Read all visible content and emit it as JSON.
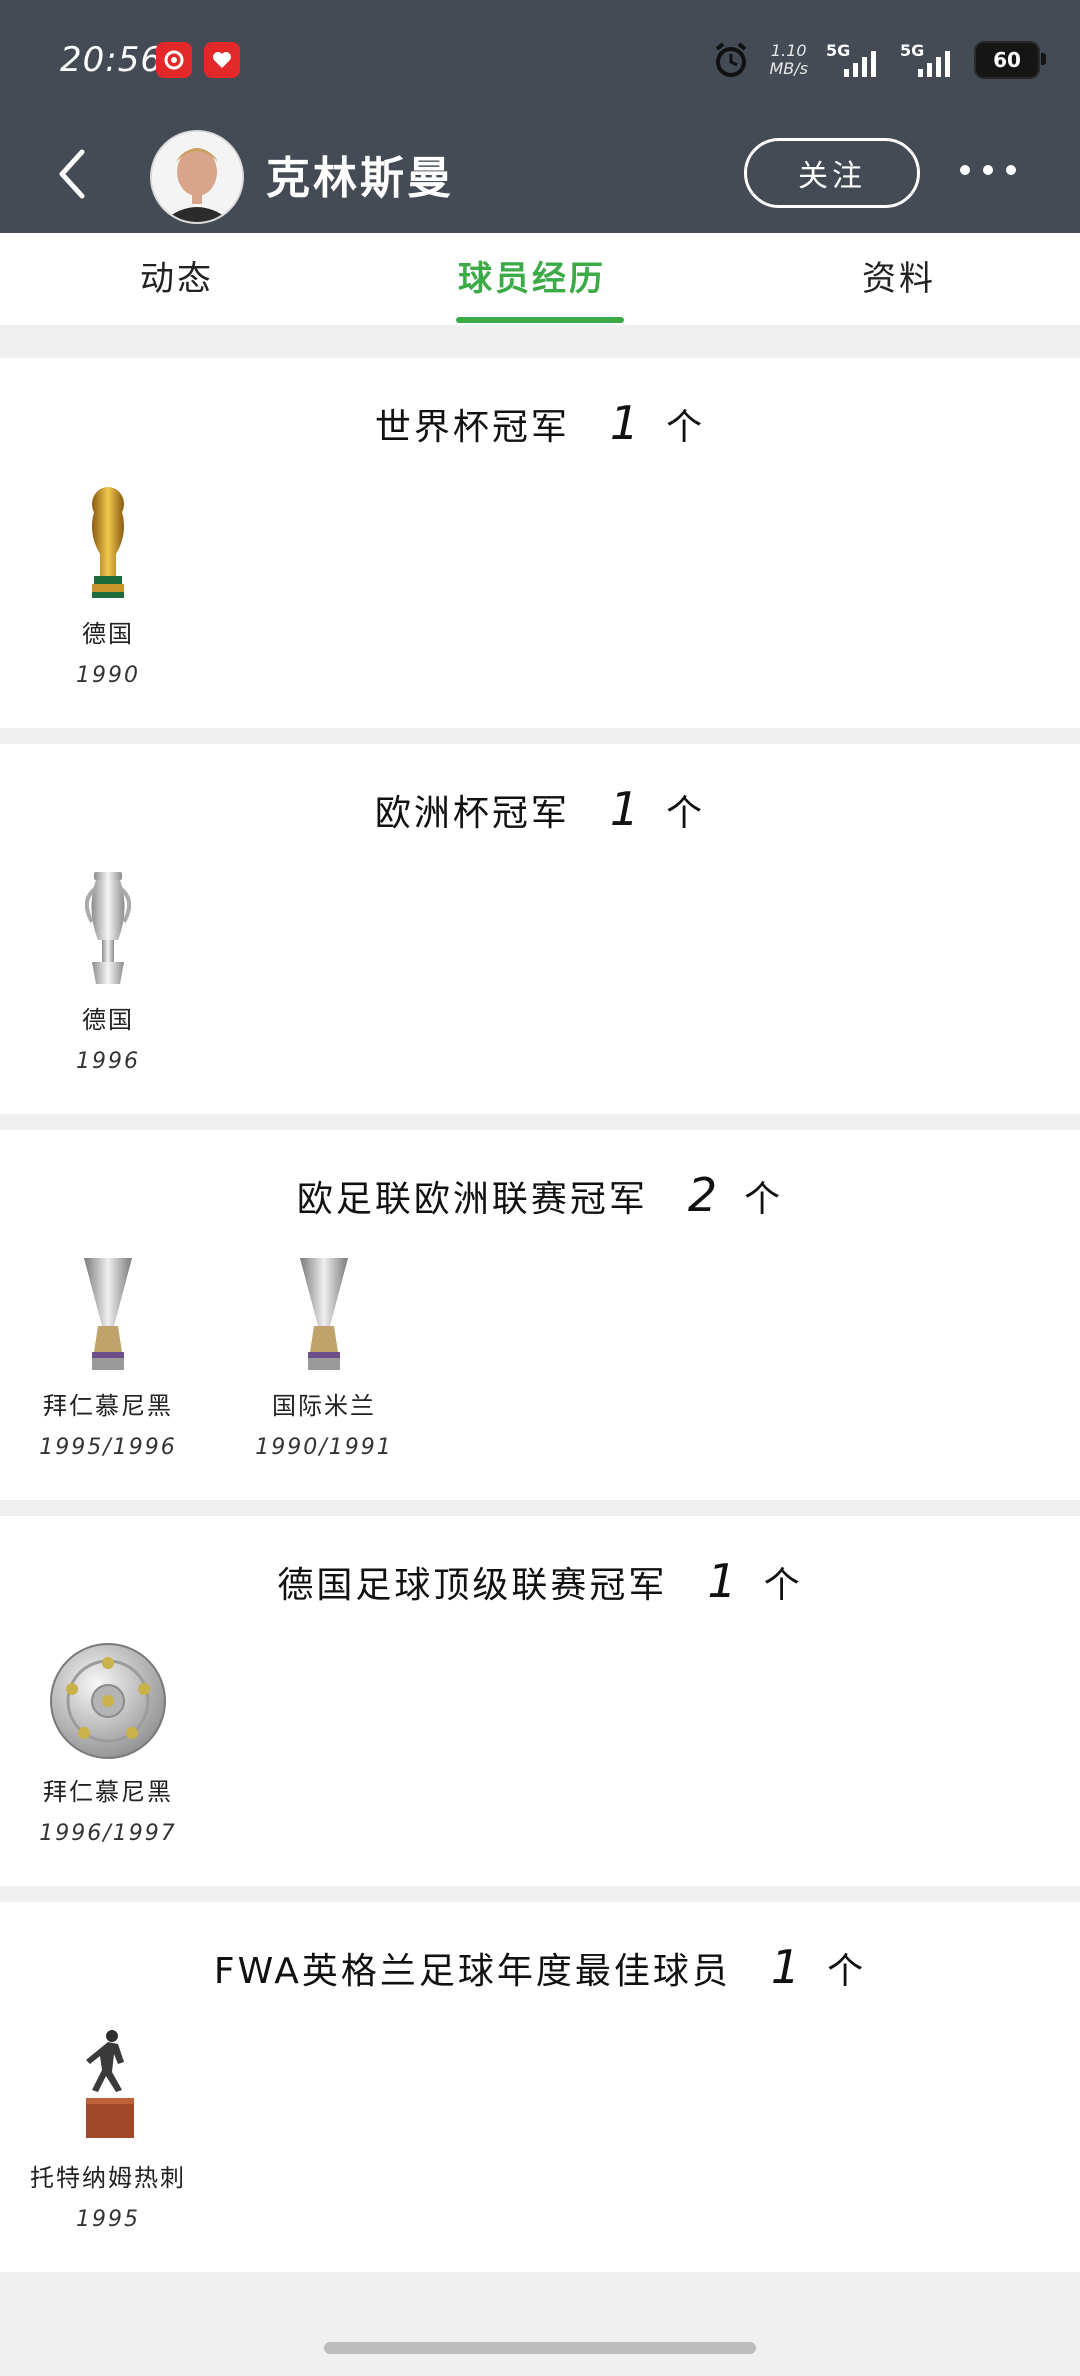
{
  "status_bar": {
    "time": "20:56",
    "net_speed_value": "1.10",
    "net_speed_unit": "MB/s",
    "sim1_label": "5G",
    "sim2_label": "5G",
    "battery": "60"
  },
  "header": {
    "player_name": "克林斯曼",
    "follow_label": "关注"
  },
  "tabs": [
    {
      "label": "动态",
      "active": false
    },
    {
      "label": "球员经历",
      "active": true
    },
    {
      "label": "资料",
      "active": false
    }
  ],
  "sections": [
    {
      "title": "世界杯冠军",
      "count": "1",
      "unit": "个",
      "trophies": [
        {
          "team": "德国",
          "year": "1990",
          "icon": "world-cup-trophy-icon"
        }
      ]
    },
    {
      "title": "欧洲杯冠军",
      "count": "1",
      "unit": "个",
      "trophies": [
        {
          "team": "德国",
          "year": "1996",
          "icon": "euro-cup-trophy-icon"
        }
      ]
    },
    {
      "title": "欧足联欧洲联赛冠军",
      "count": "2",
      "unit": "个",
      "trophies": [
        {
          "team": "拜仁慕尼黑",
          "year": "1995/1996",
          "icon": "uefa-cup-trophy-icon"
        },
        {
          "team": "国际米兰",
          "year": "1990/1991",
          "icon": "uefa-cup-trophy-icon"
        }
      ]
    },
    {
      "title": "德国足球顶级联赛冠军",
      "count": "1",
      "unit": "个",
      "trophies": [
        {
          "team": "拜仁慕尼黑",
          "year": "1996/1997",
          "icon": "bundesliga-shield-icon"
        }
      ]
    },
    {
      "title": "FWA英格兰足球年度最佳球员",
      "count": "1",
      "unit": "个",
      "trophies": [
        {
          "team": "托特纳姆热刺",
          "year": "1995",
          "icon": "fwa-statuette-icon"
        }
      ]
    }
  ],
  "colors": {
    "header_bg": "#444b55",
    "accent_green": "#3cab47",
    "page_bg": "#f0f0f0"
  }
}
